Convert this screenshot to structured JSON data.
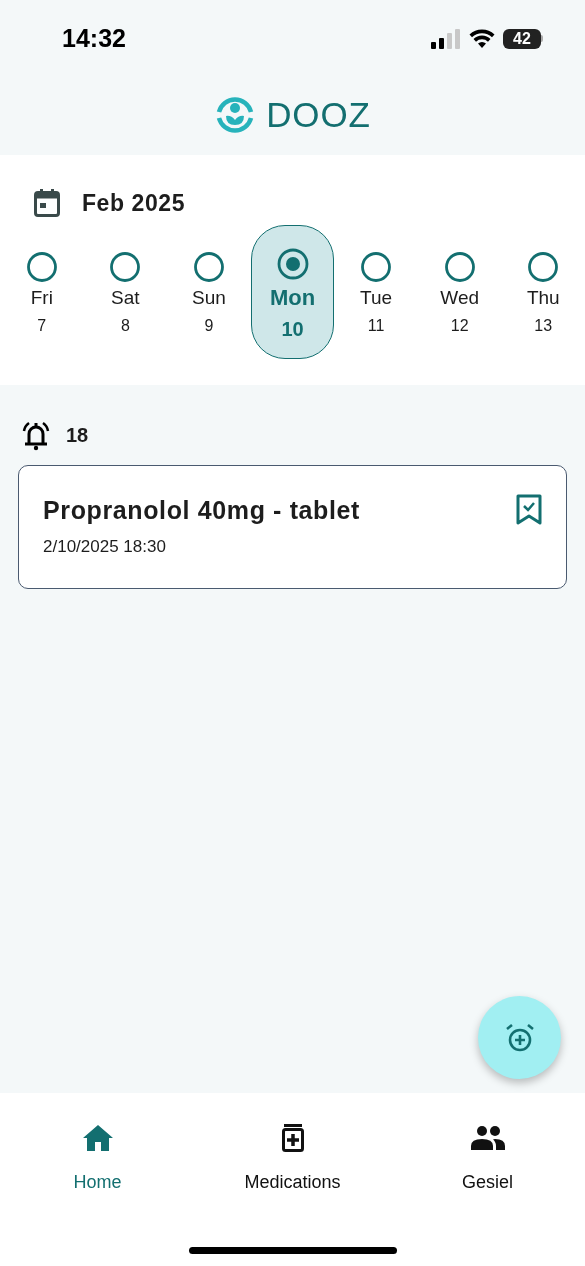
{
  "status_bar": {
    "time": "14:32",
    "battery": "42"
  },
  "header": {
    "app_name": "DOOZ"
  },
  "calendar": {
    "month": "Feb 2025",
    "days": [
      {
        "weekday": "Fri",
        "day": "7",
        "selected": false
      },
      {
        "weekday": "Sat",
        "day": "8",
        "selected": false
      },
      {
        "weekday": "Sun",
        "day": "9",
        "selected": false
      },
      {
        "weekday": "Mon",
        "day": "10",
        "selected": true
      },
      {
        "weekday": "Tue",
        "day": "11",
        "selected": false
      },
      {
        "weekday": "Wed",
        "day": "12",
        "selected": false
      },
      {
        "weekday": "Thu",
        "day": "13",
        "selected": false
      }
    ]
  },
  "reminders": {
    "hour": "18",
    "items": [
      {
        "title": "Propranolol 40mg - tablet",
        "datetime": "2/10/2025 18:30"
      }
    ]
  },
  "bottom_nav": [
    {
      "label": "Home",
      "kind": "home",
      "selected": true
    },
    {
      "label": "Medications",
      "kind": "medication",
      "selected": false
    },
    {
      "label": "Gesiel",
      "kind": "people",
      "selected": false
    }
  ]
}
